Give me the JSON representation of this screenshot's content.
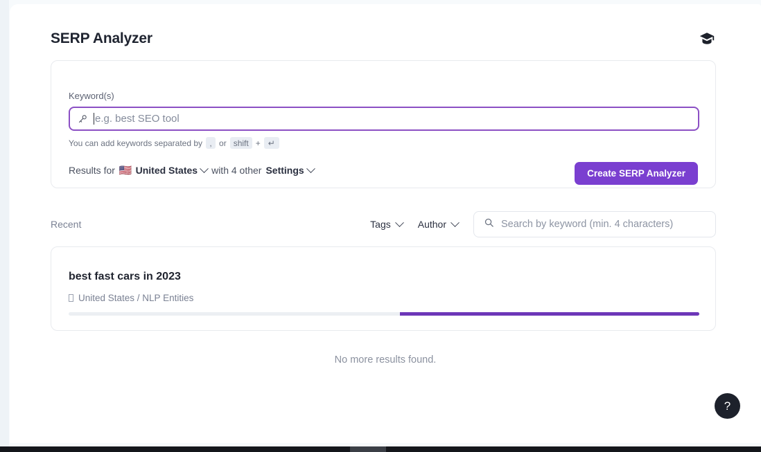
{
  "header": {
    "title": "SERP Analyzer",
    "academy_icon": "graduation-cap-icon"
  },
  "create_panel": {
    "field_label": "Keyword(s)",
    "keyword_input": {
      "value": "",
      "placeholder": "e.g. best SEO tool",
      "icon": "key-icon"
    },
    "hint": {
      "prefix": "You can add keywords separated by",
      "key_comma": ",",
      "conjunction": "or",
      "key_shift": "shift",
      "plus": "+",
      "key_enter": "↵"
    },
    "results_for": {
      "prefix": "Results for",
      "flag": "🇺🇸",
      "country": "United States",
      "middle": "with 4 other",
      "settings": "Settings"
    },
    "create_button": "Create SERP Analyzer",
    "accent_color": "#7a3fd0",
    "input_border_color": "#8b4fc4"
  },
  "recent": {
    "label": "Recent",
    "filters": [
      {
        "label": "Tags",
        "icon": "chevron-down-icon"
      },
      {
        "label": "Author",
        "icon": "chevron-down-icon"
      }
    ],
    "search": {
      "value": "",
      "placeholder": "Search by keyword (min. 4 characters)",
      "icon": "search-icon"
    }
  },
  "results": {
    "items": [
      {
        "title": "best fast cars in 2023",
        "meta_icon": "missing-glyph",
        "meta": "United States / NLP Entities",
        "progress_percent": 47.5,
        "progress_color": "#6d37b8",
        "track_color": "#eceff3"
      }
    ],
    "empty_message": "No more results found."
  },
  "help": {
    "label": "?",
    "icon": "question-mark-icon"
  }
}
